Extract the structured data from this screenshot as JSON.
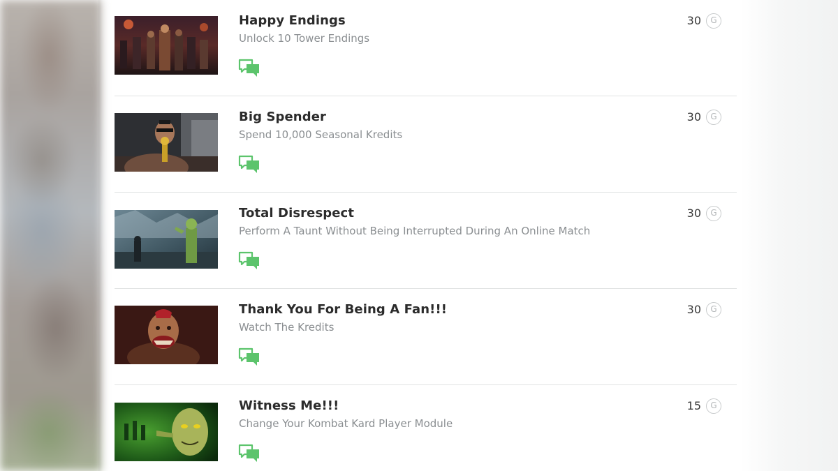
{
  "achievements": [
    {
      "title": "Happy Endings",
      "description": "Unlock 10 Tower Endings",
      "points": "30",
      "badge": "G",
      "thumbnail": "thumb-happy-endings"
    },
    {
      "title": "Big Spender",
      "description": "Spend 10,000 Seasonal Kredits",
      "points": "30",
      "badge": "G",
      "thumbnail": "thumb-big-spender"
    },
    {
      "title": "Total Disrespect",
      "description": "Perform A Taunt Without Being Interrupted During An Online Match",
      "points": "30",
      "badge": "G",
      "thumbnail": "thumb-total-disrespect"
    },
    {
      "title": "Thank You For Being A Fan!!!",
      "description": "Watch The Kredits",
      "points": "30",
      "badge": "G",
      "thumbnail": "thumb-thank-you"
    },
    {
      "title": "Witness Me!!!",
      "description": "Change Your Kombat Kard Player Module",
      "points": "15",
      "badge": "G",
      "thumbnail": "thumb-witness-me"
    }
  ],
  "icons": {
    "comment": "comments-icon",
    "gamerscore": "gamerscore-icon"
  },
  "colors": {
    "comment_icon": "#5cc46c",
    "divider": "#e1e3e3",
    "title": "#2b2b2b",
    "description": "#8a8e91"
  }
}
